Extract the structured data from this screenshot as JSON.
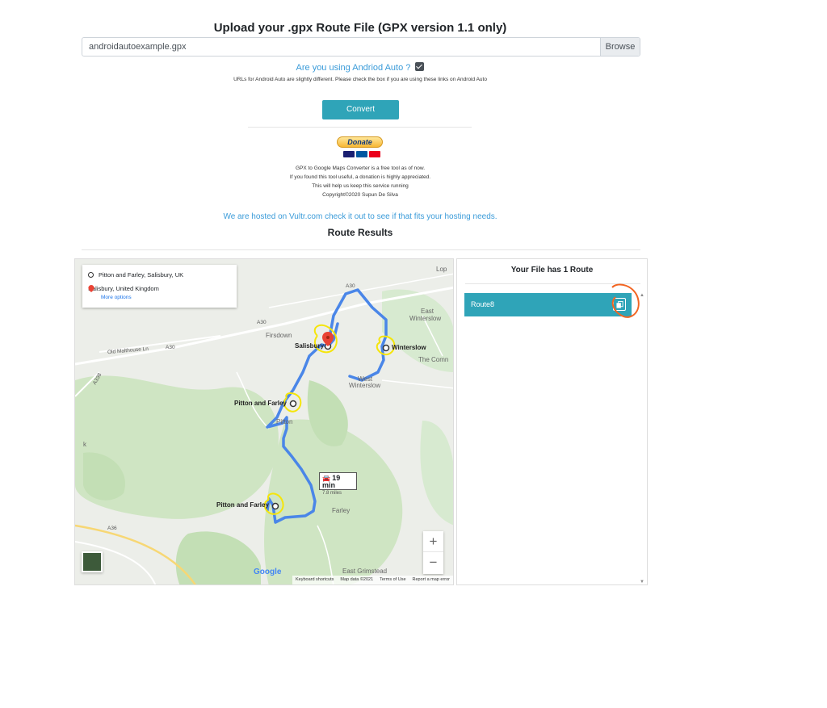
{
  "upload": {
    "title": "Upload your .gpx Route File (GPX version 1.1 only)",
    "file_name": "androidautoexample.gpx",
    "browse_label": "Browse"
  },
  "android_auto": {
    "question": "Are you using Andriod Auto ?",
    "checked": true,
    "note": "URLs for Android Auto are slightly different. Please check the box if you are using these links on Android Auto"
  },
  "convert_label": "Convert",
  "donate": {
    "button_label": "Donate",
    "line1": "GPX to Google Maps Converter is a free tool as of now.",
    "line2": "If you found this tool useful, a donation is highly appreciated.",
    "line3": "This will help us keep this service running",
    "line4": "Copyright©2020 Supun De Silva"
  },
  "hosted": {
    "prefix": "We are hosted on",
    "link": "Vultr.com",
    "suffix": "check it out to see if that fits your hosting needs."
  },
  "results_title": "Route Results",
  "map": {
    "origin": "Pitton and Farley, Salisbury, UK",
    "destination": "Salisbury, United Kingdom",
    "more_options": "More options",
    "duration": "19 min",
    "distance": "7.8 miles",
    "places": {
      "salisbury": "Salisbury",
      "winterslow": "Winterslow",
      "pitton_farley_1": "Pitton and Farley",
      "pitton_farley_2": "Pitton and Farley",
      "pitton": "Pitton",
      "farley": "Farley",
      "firsdown": "Firsdown",
      "east_winterslow_1": "East",
      "east_winterslow_2": "Winterslow",
      "west_winterslow_1": "West",
      "west_winterslow_2": "Winterslow",
      "the_common": "The Comn",
      "east_grimstead": "East Grimstead",
      "lop": "Lop",
      "k": "k",
      "a36": "A36",
      "a338": "A338",
      "a30_1": "A30",
      "a30_2": "A30",
      "a30_3": "A30",
      "old_malthouse": "Old Malthouse Ln"
    },
    "zoom_in": "+",
    "zoom_out": "−",
    "google": "Google",
    "attribution": [
      "Keyboard shortcuts",
      "Map data ©2021",
      "Terms of Use",
      "Report a map error"
    ]
  },
  "routes_panel": {
    "title": "Your File has 1 Route",
    "routes": [
      {
        "name": "Route8"
      }
    ]
  },
  "colors": {
    "teal": "#2fa4b8",
    "link_blue": "#3a9bd9",
    "route_blue": "#4a86e8",
    "annotation_yellow": "#f5e50a",
    "annotation_orange": "#f26522"
  },
  "icons": {
    "copy": "copy-icon",
    "pin": "pin-icon",
    "car": "car-icon",
    "ring": "circle-icon"
  }
}
